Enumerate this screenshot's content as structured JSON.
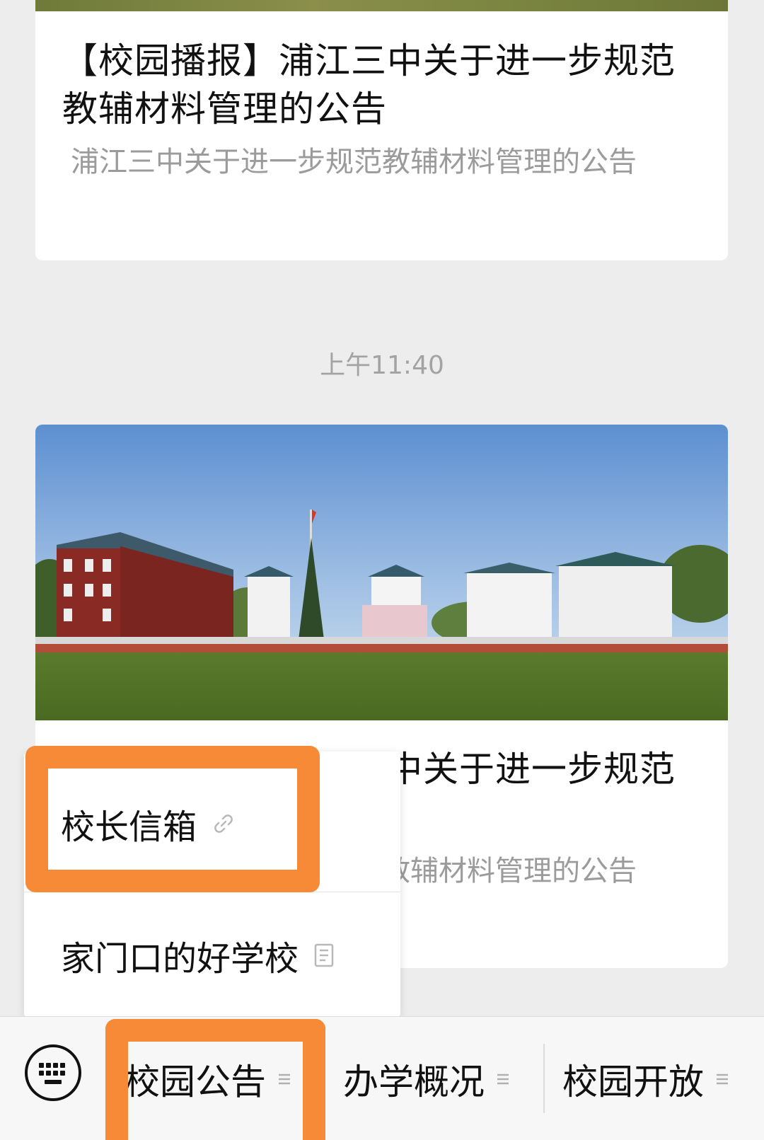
{
  "articles": [
    {
      "title": "【校园播报】浦江三中关于进一步规范教辅材料管理的公告",
      "digest": "浦江三中关于进一步规范教辅材料管理的公告"
    }
  ],
  "timestamp": "上午11:40",
  "article_main": {
    "title": "【校园播报】浦江三中关于进一步规范教辅材料管理的公告",
    "digest": "浦江三中关于进一步规范教辅材料管理的公告"
  },
  "popup_menu": {
    "items": [
      {
        "label": "校长信箱",
        "icon": "link-icon"
      },
      {
        "label": "家门口的好学校",
        "icon": "article-icon"
      }
    ]
  },
  "bottom_menu": {
    "keyboard_icon": "keyboard-icon",
    "items": [
      {
        "label": "校园公告",
        "icon": "menu-lines-icon"
      },
      {
        "label": "办学概况",
        "icon": "menu-lines-icon"
      },
      {
        "label": "校园开放",
        "icon": "menu-lines-icon"
      }
    ]
  },
  "colors": {
    "background": "#ededed",
    "card": "#ffffff",
    "highlight": "#f78a36",
    "digest_text": "#9b9b9b"
  }
}
